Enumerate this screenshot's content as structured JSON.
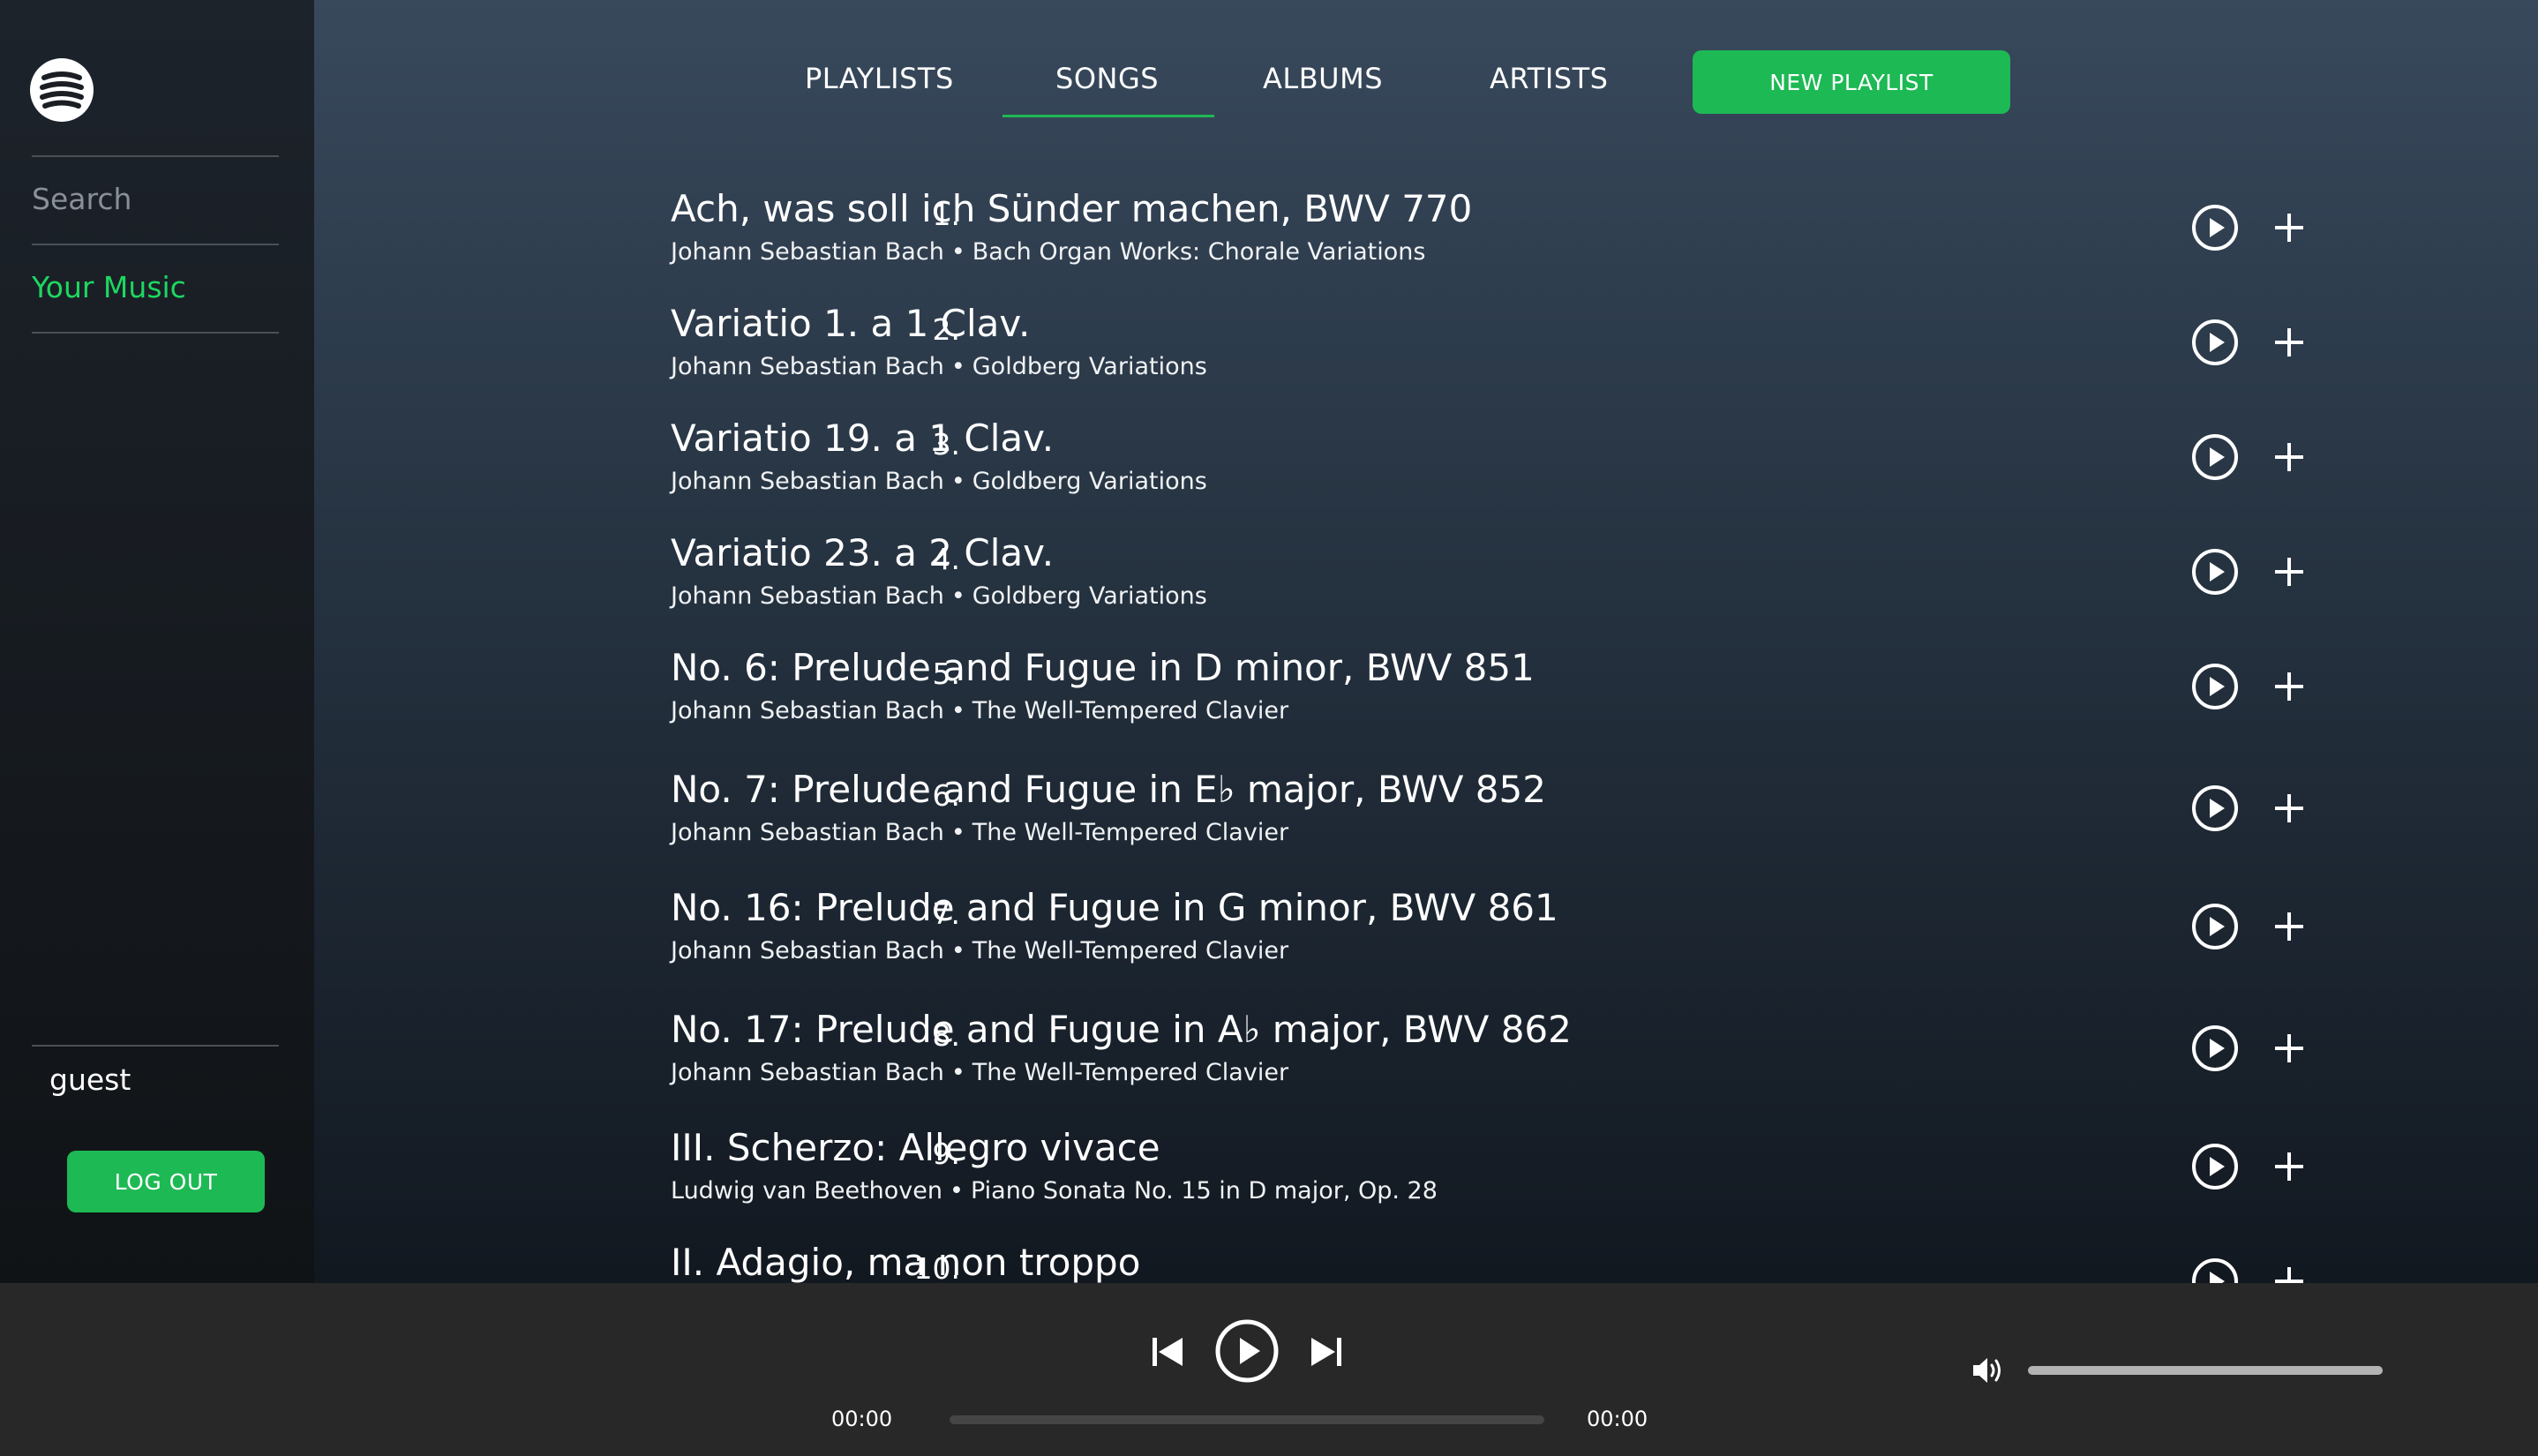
{
  "sidebar": {
    "logo": "stack-logo-icon",
    "search_label": "Search",
    "your_music_label": "Your Music",
    "username": "guest",
    "logout_label": "LOG OUT"
  },
  "nav": {
    "tabs": [
      {
        "label": "PLAYLISTS",
        "active": false
      },
      {
        "label": "SONGS",
        "active": true
      },
      {
        "label": "ALBUMS",
        "active": false
      },
      {
        "label": "ARTISTS",
        "active": false
      }
    ],
    "new_playlist_label": "NEW PLAYLIST"
  },
  "songs": [
    {
      "num": "1.",
      "title": "Ach, was soll ich Sünder machen, BWV 770",
      "artist": "Johann Sebastian Bach",
      "album": "Bach Organ Works: Chorale Variations"
    },
    {
      "num": "2.",
      "title": "Variatio 1. a 1 Clav.",
      "artist": "Johann Sebastian Bach",
      "album": "Goldberg Variations"
    },
    {
      "num": "3.",
      "title": "Variatio 19. a 1 Clav.",
      "artist": "Johann Sebastian Bach",
      "album": "Goldberg Variations"
    },
    {
      "num": "4.",
      "title": "Variatio 23. a 2 Clav.",
      "artist": "Johann Sebastian Bach",
      "album": "Goldberg Variations"
    },
    {
      "num": "5.",
      "title": "No. 6: Prelude and Fugue in D minor, BWV 851",
      "artist": "Johann Sebastian Bach",
      "album": "The Well-Tempered Clavier"
    },
    {
      "num": "6.",
      "title": "No. 7: Prelude and Fugue in E♭ major, BWV 852",
      "artist": "Johann Sebastian Bach",
      "album": "The Well-Tempered Clavier"
    },
    {
      "num": "7.",
      "title": "No. 16: Prelude and Fugue in G minor, BWV 861",
      "artist": "Johann Sebastian Bach",
      "album": "The Well-Tempered Clavier"
    },
    {
      "num": "8.",
      "title": "No. 17: Prelude and Fugue in A♭ major, BWV 862",
      "artist": "Johann Sebastian Bach",
      "album": "The Well-Tempered Clavier"
    },
    {
      "num": "9.",
      "title": "III. Scherzo: Allegro vivace",
      "artist": "Ludwig van Beethoven",
      "album": "Piano Sonata No. 15 in D major, Op. 28"
    },
    {
      "num": "10.",
      "title": "II. Adagio, ma non troppo",
      "artist": "",
      "album": ""
    }
  ],
  "icons": {
    "play": "play-circle-icon",
    "add": "plus-icon",
    "prev": "skip-previous-icon",
    "next": "skip-next-icon",
    "volume": "volume-icon"
  },
  "player": {
    "current_time": "00:00",
    "total_time": "00:00",
    "progress": 0,
    "volume": 1.0
  },
  "colors": {
    "accent": "#1db954",
    "accent_text": "#1ed760",
    "player_bg": "#282828"
  }
}
